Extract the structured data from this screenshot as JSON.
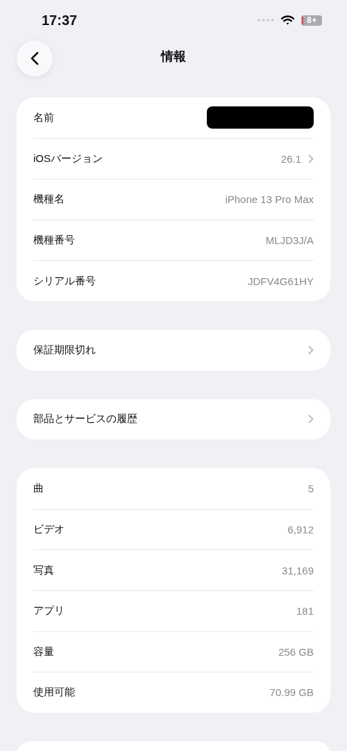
{
  "status_bar": {
    "time": "17:37",
    "battery": "8"
  },
  "header": {
    "title": "情報"
  },
  "groups": [
    {
      "rows": [
        {
          "label": "名前",
          "redacted": true,
          "chevron": false
        },
        {
          "label": "iOSバージョン",
          "value": "26.1",
          "chevron": true
        },
        {
          "label": "機種名",
          "value": "iPhone 13 Pro Max",
          "chevron": false
        },
        {
          "label": "機種番号",
          "value": "MLJD3J/A",
          "chevron": false
        },
        {
          "label": "シリアル番号",
          "value": "JDFV4G61HY",
          "chevron": false
        }
      ]
    },
    {
      "rows": [
        {
          "label": "保証期限切れ",
          "chevron": true
        }
      ]
    },
    {
      "rows": [
        {
          "label": "部品とサービスの履歴",
          "chevron": true
        }
      ]
    },
    {
      "rows": [
        {
          "label": "曲",
          "value": "5",
          "chevron": false
        },
        {
          "label": "ビデオ",
          "value": "6,912",
          "chevron": false
        },
        {
          "label": "写真",
          "value": "31,169",
          "chevron": false
        },
        {
          "label": "アプリ",
          "value": "181",
          "chevron": false
        },
        {
          "label": "容量",
          "value": "256 GB",
          "chevron": false
        },
        {
          "label": "使用可能",
          "value": "70.99 GB",
          "chevron": false
        }
      ]
    }
  ]
}
